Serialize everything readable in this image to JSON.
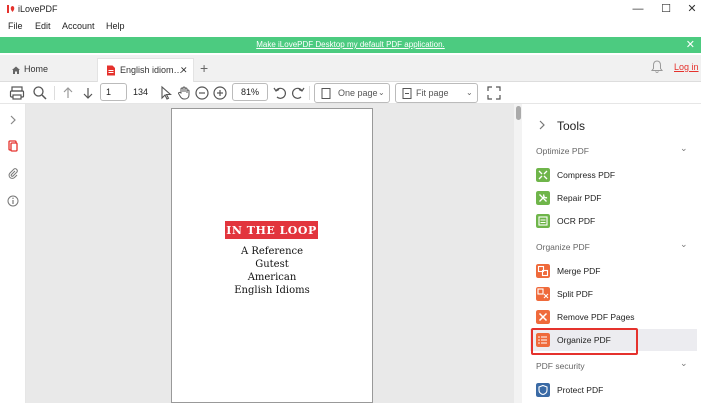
{
  "window": {
    "title": "iLovePDF",
    "controls": [
      "—",
      "☐",
      "✕"
    ]
  },
  "menu": [
    "File",
    "Edit",
    "Account",
    "Help"
  ],
  "banner": {
    "text": "Make iLovePDF Desktop my default PDF application.",
    "close": "✕"
  },
  "tabs": {
    "home": "Home",
    "document": "English idiom…",
    "document_close": "✕",
    "new_tab": "+"
  },
  "header": {
    "login": "Log in"
  },
  "toolbar": {
    "page_value": "1",
    "page_count": "134",
    "zoom_value": "81%",
    "view_mode": "One page",
    "fit_mode": "Fit page"
  },
  "document": {
    "cover_title": "IN THE LOOP",
    "lines": [
      "A Reference",
      "Gutest",
      "American",
      "English Idioms"
    ]
  },
  "tools_panel": {
    "title": "Tools",
    "sections": [
      {
        "name": "Optimize PDF",
        "items": [
          {
            "label": "Compress PDF",
            "color": "#6fb54a"
          },
          {
            "label": "Repair PDF",
            "color": "#6fb54a"
          },
          {
            "label": "OCR PDF",
            "color": "#6fb54a"
          }
        ]
      },
      {
        "name": "Organize PDF",
        "items": [
          {
            "label": "Merge PDF",
            "color": "#ef6a3b"
          },
          {
            "label": "Split PDF",
            "color": "#ef6a3b"
          },
          {
            "label": "Remove PDF Pages",
            "color": "#ef6a3b"
          },
          {
            "label": "Organize PDF",
            "color": "#ef6a3b"
          }
        ]
      },
      {
        "name": "PDF security",
        "items": [
          {
            "label": "Protect PDF",
            "color": "#3a6aa5"
          }
        ]
      }
    ]
  },
  "colors": {
    "banner": "#4ccb80",
    "accent": "#e5322d"
  }
}
